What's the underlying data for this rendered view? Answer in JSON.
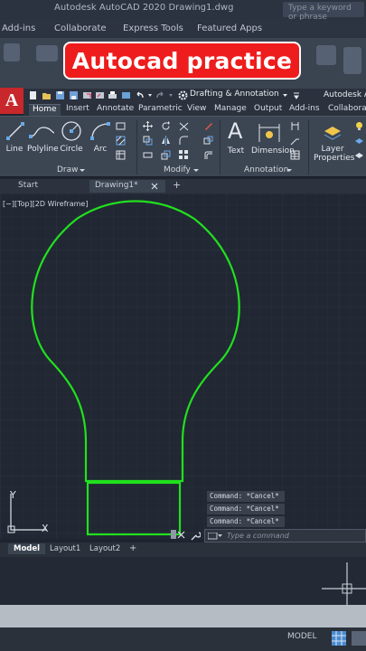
{
  "background_window": {
    "title": "Autodesk AutoCAD 2020   Drawing1.dwg",
    "search_placeholder": "Type a keyword or phrase",
    "menu": [
      "Add-ins",
      "Collaborate",
      "Express Tools",
      "Featured Apps"
    ]
  },
  "banner": {
    "text": "Autocad practice",
    "color": "#ee1c1c"
  },
  "app_button": {
    "label": "A"
  },
  "quick_access": {
    "workspace": "Drafting & Annotation",
    "app_title": "Autodesk Au"
  },
  "ribbon_tabs": [
    "Home",
    "Insert",
    "Annotate",
    "Parametric",
    "View",
    "Manage",
    "Output",
    "Add-ins",
    "Collaborate"
  ],
  "active_tab": "Home",
  "draw_tools": [
    "Line",
    "Polyline",
    "Circle",
    "Arc"
  ],
  "panels": {
    "draw": "Draw",
    "modify": "Modify",
    "annotation": "Annotation"
  },
  "annotation_tools": {
    "text": "Text",
    "dimension": "Dimension",
    "layer_properties_1": "Layer",
    "layer_properties_2": "Properties"
  },
  "doc_tabs": {
    "start": "Start",
    "drawing": "Drawing1*",
    "add": "+"
  },
  "viewport_label": "[−][Top][2D Wireframe]",
  "ucs": {
    "x": "X",
    "y": "Y"
  },
  "command_history": [
    "Command: *Cancel*",
    "Command: *Cancel*",
    "Command: *Cancel*"
  ],
  "command_placeholder": "Type a command",
  "layout_tabs": [
    "Model",
    "Layout1",
    "Layout2",
    "+"
  ],
  "status": {
    "model": "MODEL"
  },
  "colors": {
    "drawing_stroke": "#22e01f",
    "canvas": "#212833",
    "accent": "#c8282b"
  }
}
